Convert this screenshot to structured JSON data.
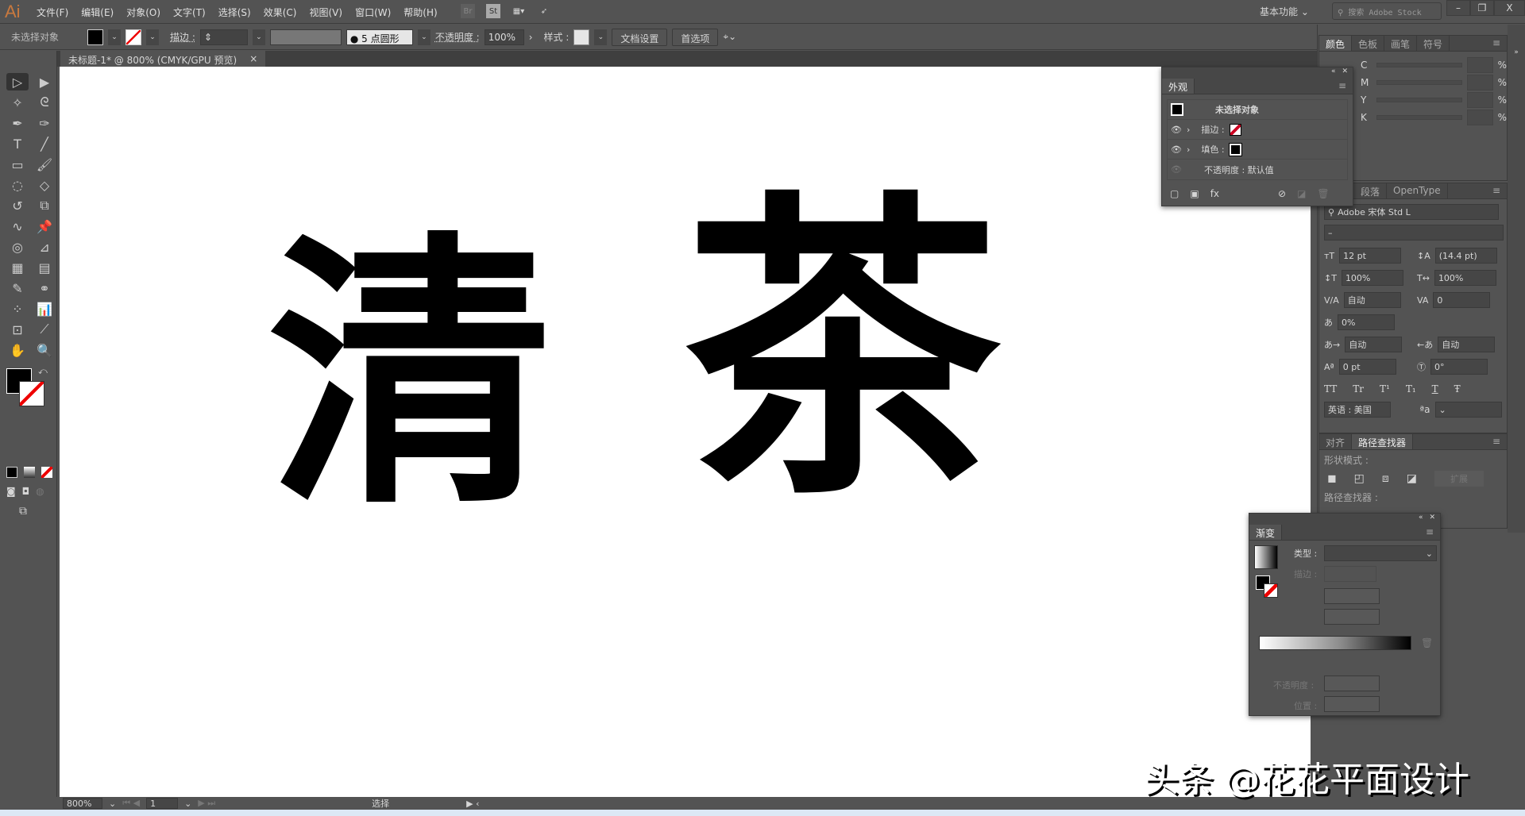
{
  "app": {
    "logo": "Ai",
    "menu": [
      "文件(F)",
      "编辑(E)",
      "对象(O)",
      "文字(T)",
      "选择(S)",
      "效果(C)",
      "视图(V)",
      "窗口(W)",
      "帮助(H)"
    ],
    "bridge": "Br",
    "stock": "St",
    "workspace": "基本功能",
    "search_placeholder": "搜索 Adobe Stock"
  },
  "control": {
    "selection": "未选择对象",
    "stroke_label": "描边 :",
    "brush": "5 点圆形",
    "opacity_label": "不透明度 :",
    "opacity": "100%",
    "style_label": "样式 :",
    "doc_setup": "文档设置",
    "prefs": "首选项"
  },
  "document": {
    "tab": "未标题-1* @ 800% (CMYK/GPU 预览)",
    "artwork": [
      "清",
      "茶"
    ]
  },
  "status": {
    "zoom": "800%",
    "page": "1",
    "tool": "选择"
  },
  "color_panel": {
    "tabs": [
      "颜色",
      "色板",
      "画笔",
      "符号"
    ],
    "channels": [
      "C",
      "M",
      "Y",
      "K"
    ],
    "unit": "%"
  },
  "appearance": {
    "title": "外观",
    "header": "未选择对象",
    "stroke": "描边 :",
    "fill": "填色 :",
    "opacity": "不透明度 : 默认值"
  },
  "character": {
    "tabs": [
      "段落",
      "OpenType"
    ],
    "font": "Adobe 宋体 Std L",
    "style": "–",
    "size": "12 pt",
    "leading": "(14.4 pt)",
    "vscale": "100%",
    "hscale": "100%",
    "kerning": "自动",
    "tracking": "0",
    "tsume": "0%",
    "aki_left": "自动",
    "aki_right": "自动",
    "baseline": "0 pt",
    "rotation": "0°",
    "language": "英语 : 美国",
    "caps": [
      "TT",
      "Tr",
      "T¹",
      "T₁",
      "T",
      "Ŧ"
    ]
  },
  "pathfinder": {
    "tabs": [
      "对齐",
      "路径查找器"
    ],
    "shape_modes": "形状模式 :",
    "expand": "扩展",
    "pathfinders": "路径查找器 :"
  },
  "gradient": {
    "title": "渐变",
    "type": "类型 :",
    "stroke": "描边 :",
    "opacity": "不透明度 :",
    "location": "位置 :"
  },
  "watermark": "头条 @花花平面设计"
}
